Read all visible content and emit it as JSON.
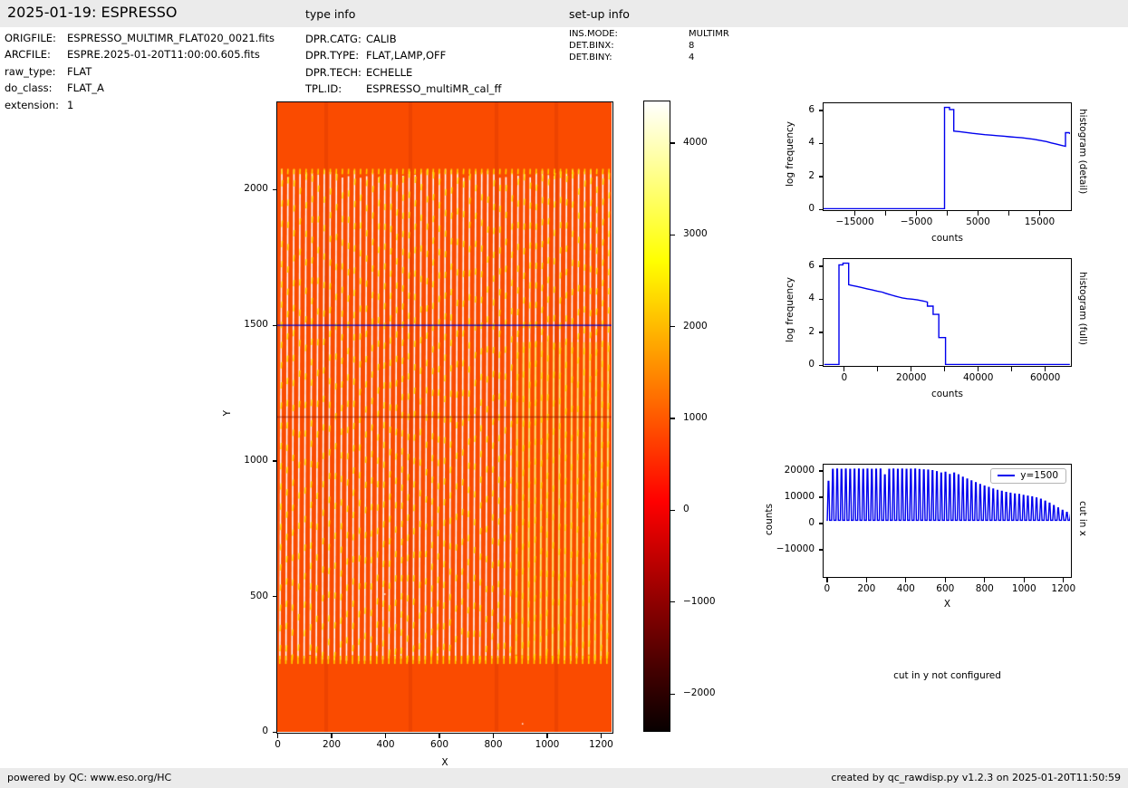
{
  "header": {
    "title": "2025-01-19: ESPRESSO",
    "type_info_label": "type info",
    "setup_info_label": "set-up info"
  },
  "file_info": {
    "rows": [
      {
        "label": "ORIGFILE:",
        "value": "ESPRESSO_MULTIMR_FLAT020_0021.fits"
      },
      {
        "label": "ARCFILE:",
        "value": "ESPRE.2025-01-20T11:00:00.605.fits"
      },
      {
        "label": "raw_type:",
        "value": "FLAT"
      },
      {
        "label": "do_class:",
        "value": "FLAT_A"
      },
      {
        "label": "extension:",
        "value": "1"
      }
    ]
  },
  "type_info": {
    "rows": [
      {
        "label": "DPR.CATG:",
        "value": "CALIB"
      },
      {
        "label": "DPR.TYPE:",
        "value": "FLAT,LAMP,OFF"
      },
      {
        "label": "DPR.TECH:",
        "value": "ECHELLE"
      },
      {
        "label": "TPL.ID:",
        "value": "ESPRESSO_multiMR_cal_ff"
      }
    ]
  },
  "setup_info": {
    "rows": [
      {
        "label": "INS.MODE:",
        "value": "MULTIMR"
      },
      {
        "label": "DET.BINX:",
        "value": "8"
      },
      {
        "label": "DET.BINY:",
        "value": "4"
      }
    ]
  },
  "cut_y_note": "cut in y not configured",
  "footer": {
    "left": "powered by QC: www.eso.org/HC",
    "right": "created by qc_rawdisp.py v1.2.3 on 2025-01-20T11:50:59"
  },
  "chart_data": [
    {
      "id": "raw-frame-image",
      "type": "heatmap",
      "xlabel": "X",
      "ylabel": "Y",
      "xlim": [
        0,
        1240
      ],
      "ylim": [
        0,
        2320
      ],
      "xticks": [
        {
          "v": 0,
          "l": "0"
        },
        {
          "v": 200,
          "l": "200"
        },
        {
          "v": 400,
          "l": "400"
        },
        {
          "v": 600,
          "l": "600"
        },
        {
          "v": 800,
          "l": "800"
        },
        {
          "v": 1000,
          "l": "1000"
        },
        {
          "v": 1200,
          "l": "1200"
        }
      ],
      "yticks": [
        {
          "v": 0,
          "l": "0"
        },
        {
          "v": 500,
          "l": "500"
        },
        {
          "v": 1000,
          "l": "1000"
        },
        {
          "v": 1500,
          "l": "1500"
        },
        {
          "v": 2000,
          "l": "2000"
        }
      ],
      "colormap": "hot",
      "background_color": "#fa4b00",
      "background_counts": 1000,
      "stripe_core_color": "#ffffff",
      "stripe_glow_color": "#ffdf00",
      "stripes": {
        "count": 55,
        "y_top": 2075,
        "y_bottom": 250
      },
      "artifact_row_y": 1163,
      "cut_line": {
        "y": 1500,
        "color": "#0000cc"
      },
      "colorbar": {
        "vmin": -2400,
        "vmax": 4450,
        "ticks": [
          {
            "v": 4000,
            "l": "4000"
          },
          {
            "v": 3000,
            "l": "3000"
          },
          {
            "v": 2000,
            "l": "2000"
          },
          {
            "v": 1000,
            "l": "1000"
          },
          {
            "v": 0,
            "l": "0"
          },
          {
            "v": -1000,
            "l": "−1000"
          },
          {
            "v": -2000,
            "l": "−2000"
          }
        ]
      }
    },
    {
      "id": "histogram-detail",
      "type": "line",
      "xlabel": "counts",
      "ylabel": "log frequency",
      "right_label": "histogram (detail)",
      "line_color": "#0000ee",
      "xlim": [
        -20000,
        20000
      ],
      "ylim": [
        0,
        6.4
      ],
      "xticks": [
        {
          "v": -15000,
          "l": "−15000"
        },
        {
          "v": -10000,
          "l": ""
        },
        {
          "v": -5000,
          "l": "−5000"
        },
        {
          "v": 0,
          "l": ""
        },
        {
          "v": 5000,
          "l": "5000"
        },
        {
          "v": 10000,
          "l": ""
        },
        {
          "v": 15000,
          "l": "15000"
        }
      ],
      "yticks": [
        {
          "v": 0,
          "l": "0"
        },
        {
          "v": 2,
          "l": "2"
        },
        {
          "v": 4,
          "l": "4"
        },
        {
          "v": 6,
          "l": "6"
        }
      ],
      "points": [
        [
          -20000,
          0.02
        ],
        [
          -350,
          0.02
        ],
        [
          -350,
          6.15
        ],
        [
          450,
          6.15
        ],
        [
          450,
          6.02
        ],
        [
          1150,
          6.02
        ],
        [
          1150,
          4.72
        ],
        [
          2200,
          4.68
        ],
        [
          3200,
          4.63
        ],
        [
          4200,
          4.58
        ],
        [
          5200,
          4.54
        ],
        [
          6200,
          4.5
        ],
        [
          7200,
          4.47
        ],
        [
          8200,
          4.44
        ],
        [
          9200,
          4.41
        ],
        [
          10200,
          4.37
        ],
        [
          11200,
          4.34
        ],
        [
          12200,
          4.31
        ],
        [
          13200,
          4.27
        ],
        [
          14200,
          4.22
        ],
        [
          15200,
          4.15
        ],
        [
          16200,
          4.08
        ],
        [
          17000,
          4.0
        ],
        [
          17800,
          3.93
        ],
        [
          18600,
          3.86
        ],
        [
          19300,
          3.8
        ],
        [
          19300,
          4.62
        ],
        [
          19900,
          4.62
        ],
        [
          20000,
          4.55
        ]
      ]
    },
    {
      "id": "histogram-full",
      "type": "line",
      "xlabel": "counts",
      "ylabel": "log frequency",
      "right_label": "histogram (full)",
      "line_color": "#0000ee",
      "xlim": [
        -6000,
        67500
      ],
      "ylim": [
        0,
        6.4
      ],
      "xticks": [
        {
          "v": 0,
          "l": "0"
        },
        {
          "v": 10000,
          "l": ""
        },
        {
          "v": 20000,
          "l": "20000"
        },
        {
          "v": 30000,
          "l": ""
        },
        {
          "v": 40000,
          "l": "40000"
        },
        {
          "v": 50000,
          "l": ""
        },
        {
          "v": 60000,
          "l": "60000"
        }
      ],
      "yticks": [
        {
          "v": 0,
          "l": "0"
        },
        {
          "v": 2,
          "l": "2"
        },
        {
          "v": 4,
          "l": "4"
        },
        {
          "v": 6,
          "l": "6"
        }
      ],
      "points": [
        [
          -5800,
          0.02
        ],
        [
          -1400,
          0.02
        ],
        [
          -1400,
          6.05
        ],
        [
          -200,
          6.05
        ],
        [
          -200,
          6.15
        ],
        [
          1500,
          6.15
        ],
        [
          1500,
          4.85
        ],
        [
          2500,
          4.8
        ],
        [
          4000,
          4.74
        ],
        [
          5500,
          4.67
        ],
        [
          7000,
          4.6
        ],
        [
          8500,
          4.53
        ],
        [
          10000,
          4.46
        ],
        [
          11500,
          4.4
        ],
        [
          12500,
          4.33
        ],
        [
          13500,
          4.27
        ],
        [
          14500,
          4.21
        ],
        [
          15500,
          4.15
        ],
        [
          16500,
          4.1
        ],
        [
          17500,
          4.05
        ],
        [
          19000,
          4.0
        ],
        [
          20500,
          3.97
        ],
        [
          22000,
          3.93
        ],
        [
          23000,
          3.89
        ],
        [
          24000,
          3.85
        ],
        [
          25000,
          3.8
        ],
        [
          25000,
          3.55
        ],
        [
          26700,
          3.55
        ],
        [
          26700,
          3.05
        ],
        [
          28400,
          3.05
        ],
        [
          28400,
          1.65
        ],
        [
          30400,
          1.65
        ],
        [
          30400,
          0.02
        ],
        [
          67500,
          0.02
        ]
      ]
    },
    {
      "id": "cut-in-x",
      "type": "line",
      "xlabel": "X",
      "ylabel": "counts",
      "right_label": "cut in x",
      "legend": {
        "label": "y=1500",
        "color": "#0000ee"
      },
      "xlim": [
        -15,
        1235
      ],
      "ylim": [
        -20200,
        22200
      ],
      "xticks": [
        {
          "v": 0,
          "l": "0"
        },
        {
          "v": 200,
          "l": "200"
        },
        {
          "v": 400,
          "l": "400"
        },
        {
          "v": 600,
          "l": "600"
        },
        {
          "v": 800,
          "l": "800"
        },
        {
          "v": 1000,
          "l": "1000"
        },
        {
          "v": 1200,
          "l": "1200"
        }
      ],
      "yticks": [
        {
          "v": 20000,
          "l": "20000"
        },
        {
          "v": 10000,
          "l": "10000"
        },
        {
          "v": 0,
          "l": "0"
        },
        {
          "v": -10000,
          "l": "−10000"
        }
      ],
      "baseline": 1000,
      "peaks": [
        [
          10,
          15800
        ],
        [
          32,
          20400
        ],
        [
          54,
          20500
        ],
        [
          76,
          20400
        ],
        [
          98,
          20500
        ],
        [
          120,
          20400
        ],
        [
          142,
          20450
        ],
        [
          164,
          20500
        ],
        [
          186,
          20400
        ],
        [
          208,
          20500
        ],
        [
          230,
          20400
        ],
        [
          252,
          20450
        ],
        [
          274,
          20500
        ],
        [
          296,
          18300
        ],
        [
          318,
          20400
        ],
        [
          340,
          20500
        ],
        [
          362,
          20400
        ],
        [
          384,
          20500
        ],
        [
          406,
          20400
        ],
        [
          428,
          20450
        ],
        [
          450,
          20500
        ],
        [
          472,
          20300
        ],
        [
          494,
          20200
        ],
        [
          516,
          20100
        ],
        [
          538,
          19900
        ],
        [
          560,
          19500
        ],
        [
          582,
          19000
        ],
        [
          604,
          19300
        ],
        [
          626,
          18400
        ],
        [
          648,
          19000
        ],
        [
          670,
          18300
        ],
        [
          692,
          17400
        ],
        [
          714,
          16700
        ],
        [
          736,
          16000
        ],
        [
          758,
          15300
        ],
        [
          780,
          14600
        ],
        [
          802,
          14000
        ],
        [
          824,
          13500
        ],
        [
          846,
          12900
        ],
        [
          868,
          12400
        ],
        [
          890,
          12000
        ],
        [
          912,
          11600
        ],
        [
          934,
          11300
        ],
        [
          956,
          11000
        ],
        [
          978,
          10800
        ],
        [
          1000,
          10500
        ],
        [
          1022,
          10200
        ],
        [
          1044,
          9900
        ],
        [
          1066,
          9500
        ],
        [
          1088,
          9000
        ],
        [
          1110,
          8300
        ],
        [
          1132,
          7500
        ],
        [
          1154,
          6600
        ],
        [
          1176,
          5700
        ],
        [
          1198,
          4800
        ],
        [
          1220,
          4000
        ],
        [
          1240,
          3300
        ]
      ]
    }
  ]
}
